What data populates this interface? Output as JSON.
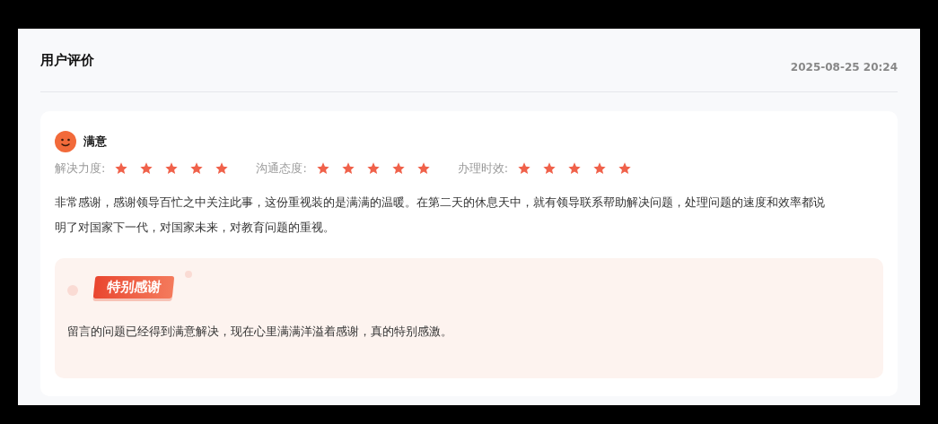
{
  "title": "用户评价",
  "timestamp": "2025-08-25 20:24",
  "review": {
    "mood": "满意",
    "ratings": [
      {
        "label": "解决力度:",
        "stars": 5
      },
      {
        "label": "沟通态度:",
        "stars": 5
      },
      {
        "label": "办理时效:",
        "stars": 5
      }
    ],
    "comment": "非常感谢，感谢领导百忙之中关注此事，这份重视装的是满满的温暖。在第二天的休息天中，就有领导联系帮助解决问题，处理问题的速度和效率都说明了对国家下一代，对国家未来，对教育问题的重视。",
    "thanks": {
      "badge": "特别感谢",
      "message": "留言的问题已经得到满意解决，现在心里满满洋溢着感谢，真的特别感激。"
    }
  }
}
